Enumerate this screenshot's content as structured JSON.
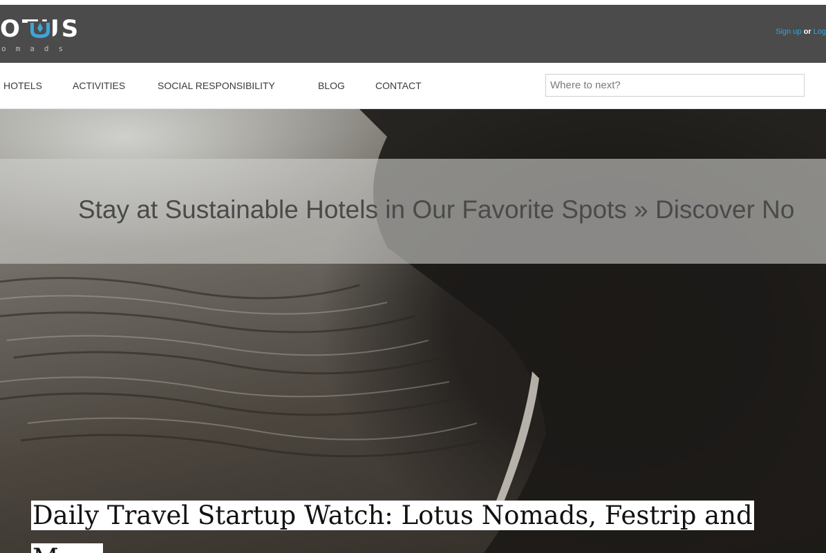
{
  "header": {
    "logo_text": "OTUS",
    "logo_subtext": "omads",
    "sign_up": "Sign up",
    "or_text": "or",
    "log_in": "Log"
  },
  "nav": {
    "items": [
      "HOTELS",
      "ACTIVITIES",
      "SOCIAL RESPONSIBILITY",
      "BLOG",
      "CONTACT"
    ],
    "search_placeholder": "Where to next?"
  },
  "hero": {
    "banner_text": "Stay at Sustainable Hotels in Our Favorite Spots » Discover No",
    "article_title": "Daily Travel Startup Watch: Lotus Nomads, Festrip and More"
  },
  "colors": {
    "header_bg": "#4b4b4b",
    "accent_blue": "#2aa8e0",
    "lotus_icon": "#3fa4d8"
  },
  "icons": [
    "lotus-icon"
  ]
}
